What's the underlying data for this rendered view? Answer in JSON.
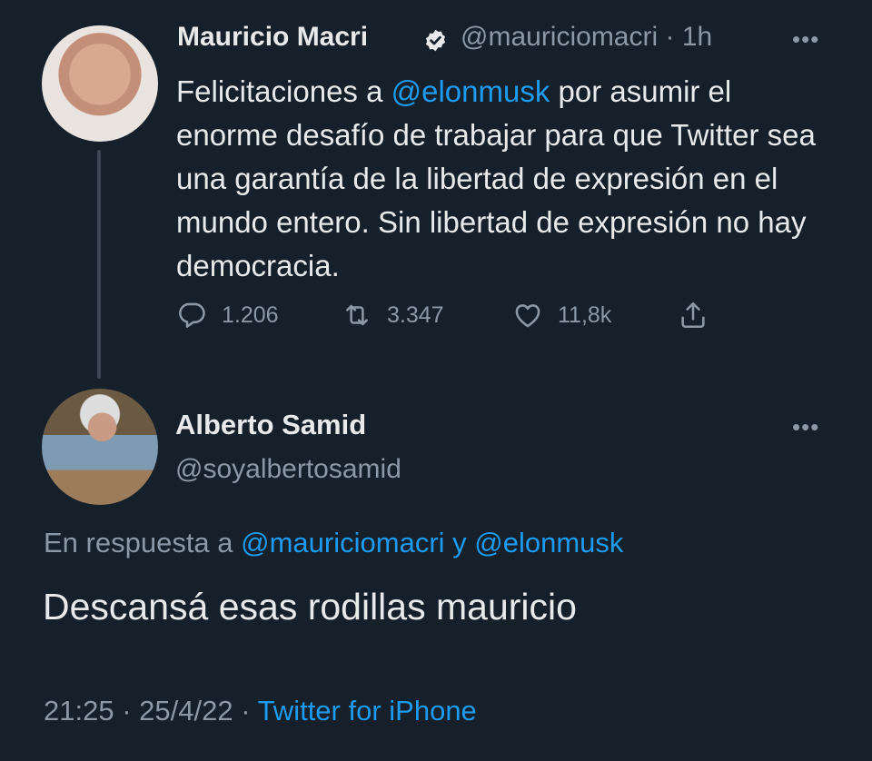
{
  "tweet": {
    "author_name": "Mauricio Macri",
    "author_handle": "@mauriciomacri",
    "time_sep": " · ",
    "time": "1h",
    "more_label": "•••",
    "text_before": "Felicitaciones a ",
    "mention": "@elonmusk",
    "text_after": " por asumir el enorme desafío de trabajar para que Twitter sea una garantía de la libertad de expresión en el mundo entero. Sin libertad de expresión no hay democracia.",
    "actions": {
      "replies": "1.206",
      "retweets": "3.347",
      "likes": "11,8k"
    },
    "icons": {
      "verified": "verified-badge-icon",
      "reply": "reply-bubble-icon",
      "retweet": "retweet-icon",
      "like": "heart-icon",
      "share": "share-icon"
    }
  },
  "reply": {
    "author_name": "Alberto Samid",
    "author_handle": "@soyalbertosamid",
    "more_label": "•••",
    "replying_prefix": "En respuesta a ",
    "replying_to_1": "@mauriciomacri",
    "replying_join": " y ",
    "replying_to_2": "@elonmusk",
    "text": "Descansá esas rodillas mauricio",
    "time": "21:25",
    "sep1": " · ",
    "date": "25/4/22",
    "sep2": " · ",
    "source": "Twitter for iPhone"
  },
  "colors": {
    "background": "#15202b",
    "accent": "#1d9bf0",
    "muted": "#8b98a5",
    "text": "#e7e9ea"
  }
}
